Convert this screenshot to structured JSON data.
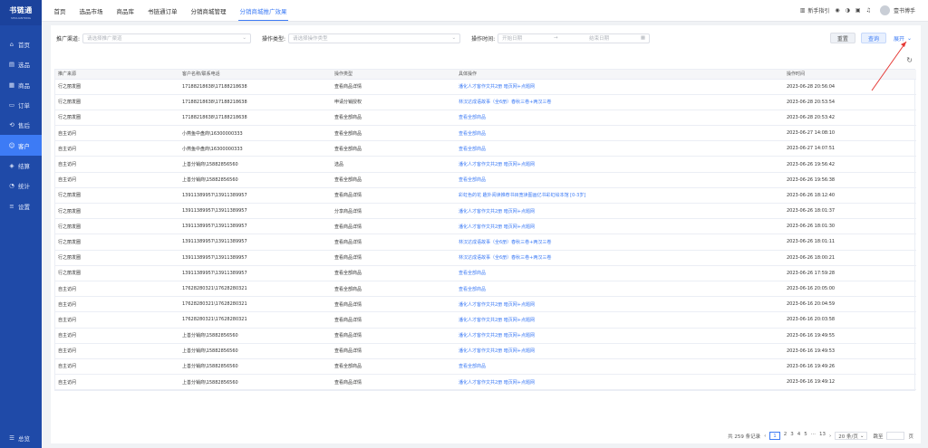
{
  "brand": {
    "name": "书链通",
    "sub": "SHULIANTONG"
  },
  "sidebar": {
    "items": [
      {
        "icon": "home-icon",
        "glyph": "⌂",
        "label": "首页"
      },
      {
        "icon": "shop-icon",
        "glyph": "▤",
        "label": "选品"
      },
      {
        "icon": "goods-icon",
        "glyph": "▦",
        "label": "商品"
      },
      {
        "icon": "order-icon",
        "glyph": "▭",
        "label": "订单"
      },
      {
        "icon": "aftersale-icon",
        "glyph": "⟲",
        "label": "售后"
      },
      {
        "icon": "customer-icon",
        "glyph": "☺",
        "label": "客户"
      },
      {
        "icon": "settlement-icon",
        "glyph": "◈",
        "label": "结算"
      },
      {
        "icon": "stats-icon",
        "glyph": "◔",
        "label": "统计"
      },
      {
        "icon": "settings-icon",
        "glyph": "≡",
        "label": "设置"
      }
    ],
    "footer_label": "总览",
    "footer_glyph": "☰"
  },
  "topbar": {
    "tabs": [
      "首页",
      "选品市场",
      "商品库",
      "书链通订单",
      "分销商城管理",
      "分销商城推广效果"
    ],
    "newbie_guide": "新手指引",
    "username": "壹书博手"
  },
  "filters": {
    "channel_label": "推广渠道:",
    "channel_placeholder": "请选择推广渠道",
    "op_label": "操作类型:",
    "op_placeholder": "请选择操作类型",
    "time_label": "操作时间:",
    "start_placeholder": "开始日期",
    "end_placeholder": "结束日期",
    "range_sep": "→",
    "reset": "重置",
    "query": "查询",
    "expand": "展开"
  },
  "table": {
    "columns": [
      "推广来源",
      "客户名称/联系电话",
      "操作类型",
      "具体操作",
      "操作时间"
    ],
    "rows": [
      [
        "行之丽发圈",
        "17188218638\\17188218638",
        "查看商品详情",
        "潘化人才客作文共2册 暗页网+点题网",
        "2023-06-28 20:56:04"
      ],
      [
        "行之丽发圈",
        "17188218638\\17188218638",
        "申请分销授权",
        "林汉达成语故事（全6册）春秋三卷+两汉三卷",
        "2023-06-28 20:53:54"
      ],
      [
        "行之丽发圈",
        "17188218638\\17188218638",
        "查看全部商品",
        "查看全部商品",
        "2023-06-28 20:53:42"
      ],
      [
        "自主访问",
        "小燕鱼中盘商\\16300000333",
        "查看全部商品",
        "查看全部商品",
        "2023-06-27 14:08:10"
      ],
      [
        "自主访问",
        "小燕鱼中盘商\\16300000333",
        "查看全部商品",
        "查看全部商品",
        "2023-06-27 14:07:51"
      ],
      [
        "自主访问",
        "上善分销商\\15882856560",
        "选品",
        "潘化人才客作文共2册 暗页网+点题网",
        "2023-06-26 19:56:42"
      ],
      [
        "自主访问",
        "上善分销商\\15882856560",
        "查看全部商品",
        "查看全部商品",
        "2023-06-26 19:56:38"
      ],
      [
        "行之丽发圈",
        "13911389957\\13911389957",
        "查看商品详情",
        "彩虹色的花 趣外阅读推荐书目宽读图画亿书彩虹绘本馆 [0-3岁]",
        "2023-06-26 18:12:40"
      ],
      [
        "行之丽发圈",
        "13911389957\\13911389957",
        "分享商品详情",
        "潘化人才客作文共2册 暗页网+点题网",
        "2023-06-26 18:01:37"
      ],
      [
        "行之丽发圈",
        "13911389957\\13911389957",
        "查看商品详情",
        "潘化人才客作文共2册 暗页网+点题网",
        "2023-06-26 18:01:30"
      ],
      [
        "行之丽发圈",
        "13911389957\\13911389957",
        "查看商品详情",
        "林汉达成语故事（全6册）春秋三卷+两汉三卷",
        "2023-06-26 18:01:11"
      ],
      [
        "行之丽发圈",
        "13911389957\\13911389957",
        "查看商品详情",
        "林汉达成语故事（全6册）春秋三卷+两汉三卷",
        "2023-06-26 18:00:21"
      ],
      [
        "行之丽发圈",
        "13911389957\\13911389957",
        "查看全部商品",
        "查看全部商品",
        "2023-06-26 17:59:28"
      ],
      [
        "自主访问",
        "17628280321\\17628280321",
        "查看全部商品",
        "查看全部商品",
        "2023-06-16 20:05:00"
      ],
      [
        "自主访问",
        "17628280321\\17628280321",
        "查看商品详情",
        "潘化人才客作文共2册 暗页网+点题网",
        "2023-06-16 20:04:59"
      ],
      [
        "自主访问",
        "17628280321\\17628280321",
        "查看商品详情",
        "潘化人才客作文共2册 暗页网+点题网",
        "2023-06-16 20:03:58"
      ],
      [
        "自主访问",
        "上善分销商\\15882856560",
        "查看商品详情",
        "潘化人才客作文共2册 暗页网+点题网",
        "2023-06-16 19:49:55"
      ],
      [
        "自主访问",
        "上善分销商\\15882856560",
        "查看商品详情",
        "潘化人才客作文共2册 暗页网+点题网",
        "2023-06-16 19:49:53"
      ],
      [
        "自主访问",
        "上善分销商\\15882856560",
        "查看全部商品",
        "查看全部商品",
        "2023-06-16 19:49:26"
      ],
      [
        "自主访问",
        "上善分销商\\15882856560",
        "查看商品详情",
        "潘化人才客作文共2册 暗页网+点题网",
        "2023-06-16 19:49:12"
      ]
    ]
  },
  "pagination": {
    "total": "共 259 条记录",
    "prev": "‹",
    "pages": [
      "1",
      "2",
      "3",
      "4",
      "5",
      "···",
      "13"
    ],
    "next": "›",
    "page_size": "20 条/页",
    "jump_label": "跳至",
    "page_unit": "页"
  },
  "colors": {
    "sidebar": "#1f4aa8",
    "accent": "#3d7bf5",
    "annotation_arrow": "#e53935"
  }
}
